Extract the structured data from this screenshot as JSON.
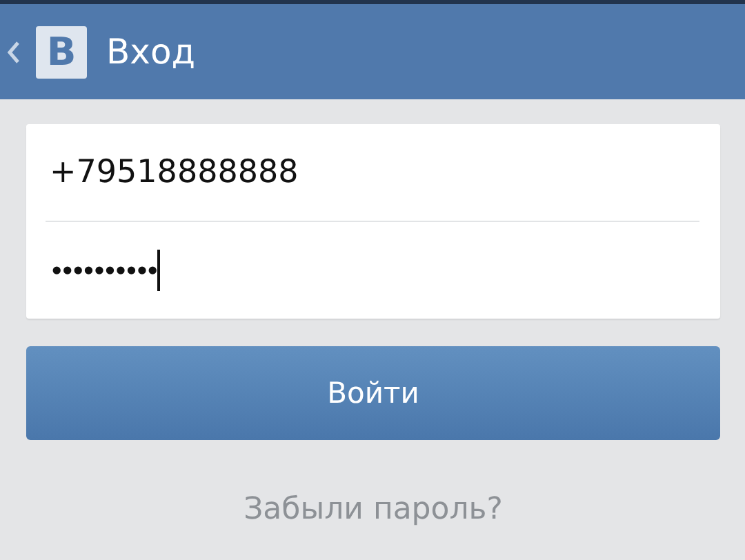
{
  "header": {
    "logo": "В",
    "title": "Вход"
  },
  "form": {
    "fields": [
      {
        "kind": "phone",
        "value": "+79518888888",
        "focused": false
      },
      {
        "kind": "password",
        "value": "••••••••••",
        "focused": true
      }
    ]
  },
  "login_button": "Войти",
  "forgot_password_link": "Забыли пароль?"
}
